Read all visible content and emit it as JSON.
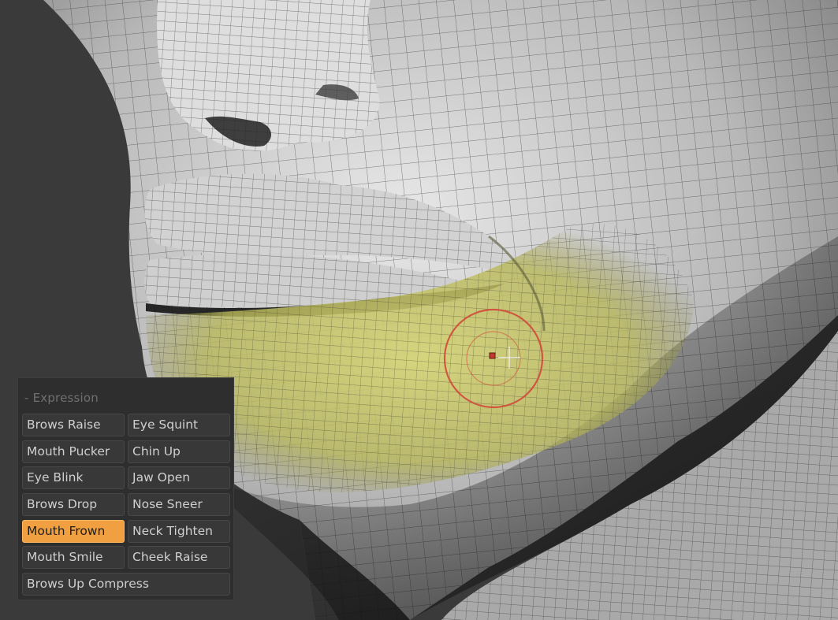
{
  "panel": {
    "header": "- Expression",
    "buttons": [
      {
        "label": "Brows Raise",
        "active": false
      },
      {
        "label": "Eye Squint",
        "active": false
      },
      {
        "label": "Mouth Pucker",
        "active": false
      },
      {
        "label": "Chin Up",
        "active": false
      },
      {
        "label": "Eye Blink",
        "active": false
      },
      {
        "label": "Jaw Open",
        "active": false
      },
      {
        "label": "Brows Drop",
        "active": false
      },
      {
        "label": "Nose Sneer",
        "active": false
      },
      {
        "label": "Mouth Frown",
        "active": true
      },
      {
        "label": "Neck Tighten",
        "active": false
      },
      {
        "label": "Mouth Smile",
        "active": false
      },
      {
        "label": "Cheek Raise",
        "active": false
      },
      {
        "label": "Brows Up Compress",
        "active": false
      }
    ]
  },
  "colors": {
    "active_button": "#f0a040",
    "mask_tint": "#c9c86a",
    "brush_ring": "#d24a3a",
    "background": "#3a3a3a"
  },
  "icons": {
    "cursor": "crosshair-icon",
    "brush": "brush-circle-icon"
  }
}
